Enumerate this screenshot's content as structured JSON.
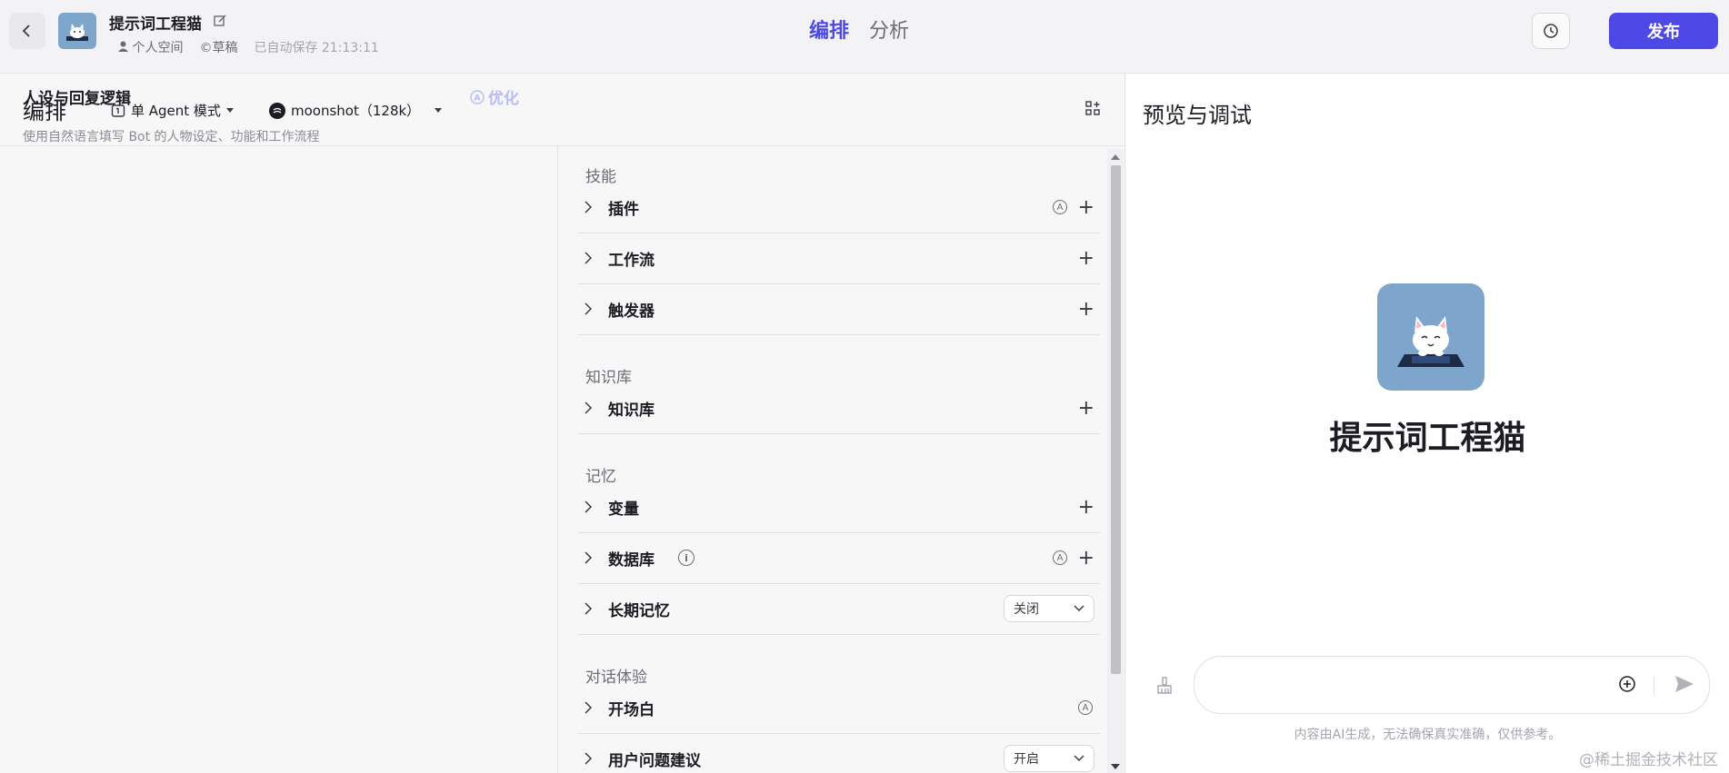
{
  "header": {
    "bot_name": "提示词工程猫",
    "space": "个人空间",
    "status": "©草稿",
    "autosave": "已自动保存 21:13:11",
    "tabs": [
      "编排",
      "分析"
    ],
    "publish_label": "发布"
  },
  "editor": {
    "title": "编排",
    "mode_label": "单 Agent 模式",
    "model_label": "moonshot（128k）",
    "persona_title": "人设与回复逻辑",
    "optimize_label": "优化",
    "persona_placeholder": "使用自然语言填写 Bot 的人物设定、功能和工作流程"
  },
  "groups": {
    "skills": "技能",
    "knowledge": "知识库",
    "memory": "记忆",
    "dialog": "对话体验"
  },
  "rows": {
    "plugin": "插件",
    "workflow": "工作流",
    "trigger": "触发器",
    "knowledge": "知识库",
    "variable": "变量",
    "database": "数据库",
    "long_memory": "长期记忆",
    "long_memory_value": "关闭",
    "opening": "开场白",
    "suggestion": "用户问题建议",
    "suggestion_value": "开启"
  },
  "preview": {
    "title": "预览与调试",
    "bot_name": "提示词工程猫",
    "disclaimer": "内容由AI生成，无法确保真实准确，仅供参考。"
  },
  "watermark": "@稀土掘金技术社区",
  "colors": {
    "accent": "#4e49e6",
    "avatar_bg": "#7ea6cc"
  }
}
